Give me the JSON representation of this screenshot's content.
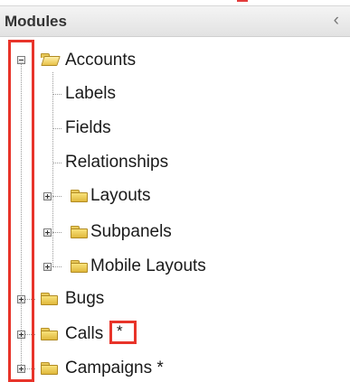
{
  "header": {
    "title": "Modules",
    "collapse_icon": "‹"
  },
  "tree": {
    "accounts": {
      "label": "Accounts",
      "children": {
        "labels": "Labels",
        "fields": "Fields",
        "relationships": "Relationships",
        "layouts": "Layouts",
        "subpanels": "Subpanels",
        "mobile_layouts": "Mobile Layouts"
      }
    },
    "bugs": "Bugs",
    "calls": {
      "label": "Calls",
      "marker": "*"
    },
    "campaigns": "Campaigns *"
  },
  "highlight_color": "#e8342a",
  "folder_color": "#e8c95a"
}
